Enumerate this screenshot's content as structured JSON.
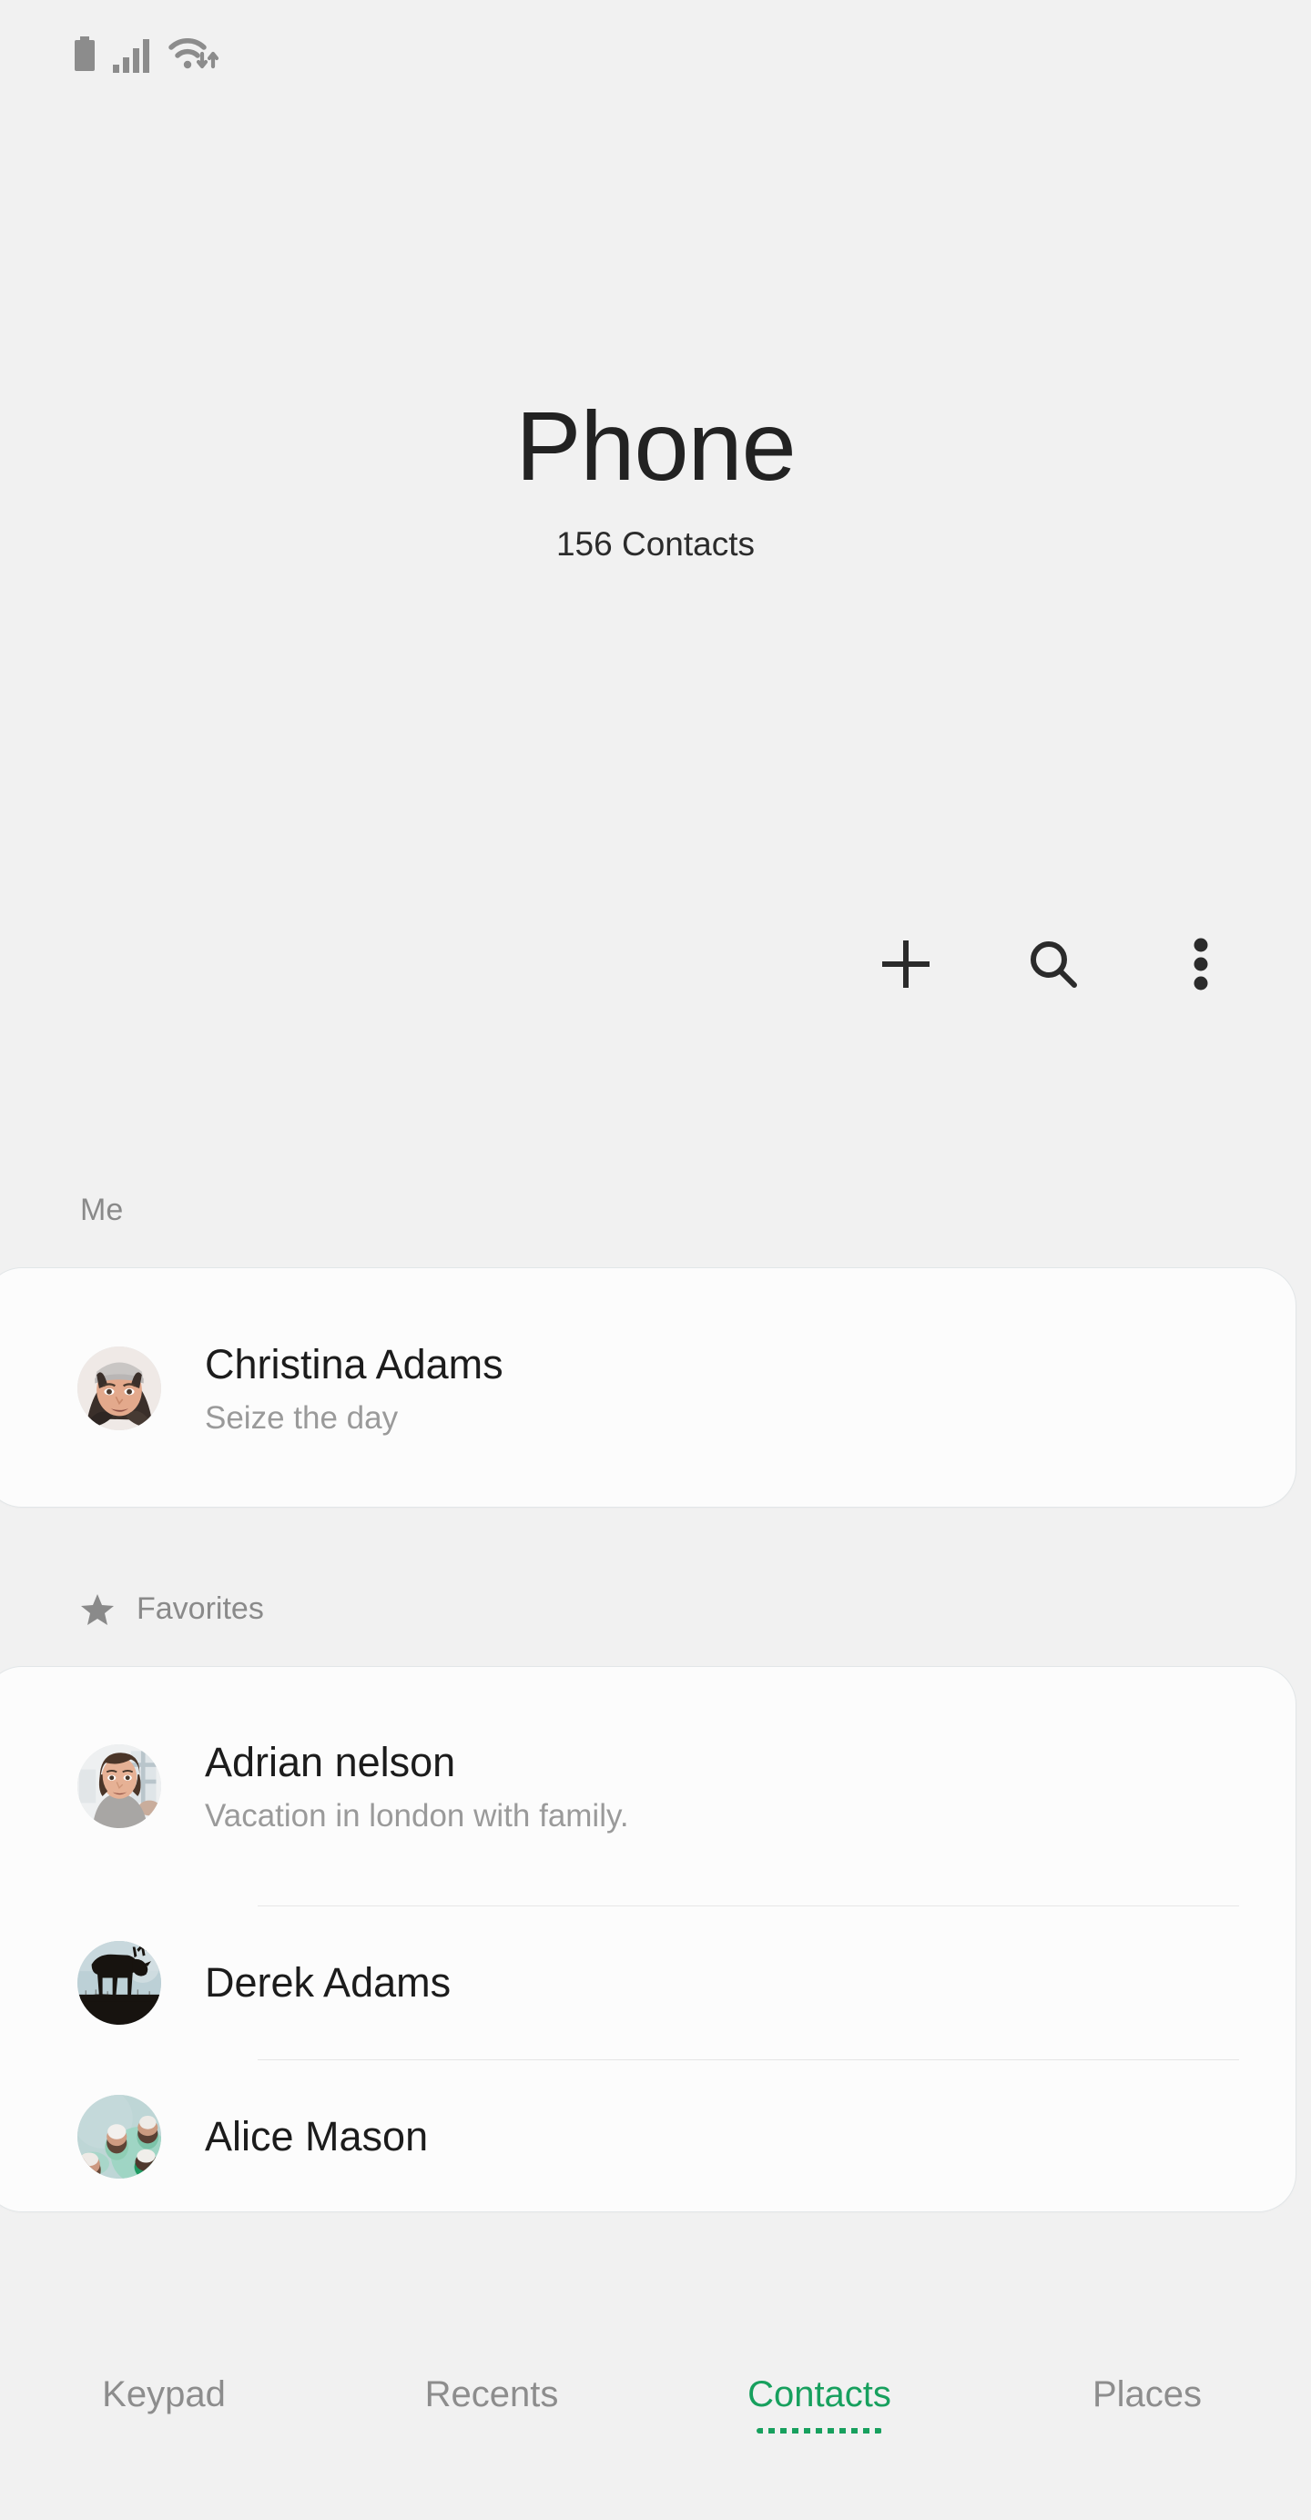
{
  "status_bar": {
    "icons": [
      "battery-icon",
      "signal-bars-icon",
      "wifi-icon"
    ]
  },
  "header": {
    "title": "Phone",
    "subtitle": "156 Contacts"
  },
  "actions": [
    {
      "name": "add-contact-button",
      "icon": "plus-icon"
    },
    {
      "name": "search-button",
      "icon": "search-icon"
    },
    {
      "name": "more-options-button",
      "icon": "more-vertical-icon"
    }
  ],
  "sections": {
    "me": {
      "label": "Me",
      "contact": {
        "name": "Christina Adams",
        "status": "Seize the day",
        "avatar": "woman-beanie-photo"
      }
    },
    "favorites": {
      "label": "Favorites",
      "icon": "star-icon",
      "contacts": [
        {
          "name": "Adrian nelson",
          "status": "Vacation in london with family.",
          "avatar": "woman-bob-hair-photo"
        },
        {
          "name": "Derek Adams",
          "status": "",
          "avatar": "deer-silhouette-photo"
        },
        {
          "name": "Alice Mason",
          "status": "",
          "avatar": "teal-stones-photo"
        }
      ]
    }
  },
  "bottom_nav": {
    "items": [
      {
        "label": "Keypad",
        "active": false
      },
      {
        "label": "Recents",
        "active": false
      },
      {
        "label": "Contacts",
        "active": true
      },
      {
        "label": "Places",
        "active": false
      }
    ]
  },
  "colors": {
    "accent_green": "#17a05e",
    "page_background": "#f1f1f1",
    "card_background": "#fcfcfc",
    "primary_text": "#1c1c1c",
    "secondary_text": "#9a9a9a",
    "section_label_text": "#8a8a8a"
  }
}
